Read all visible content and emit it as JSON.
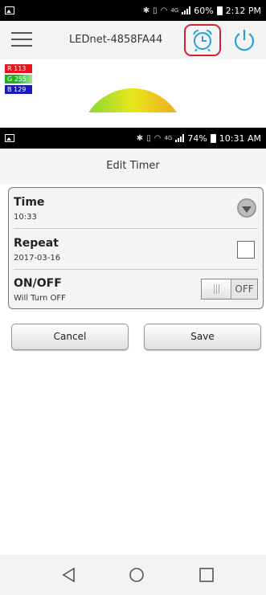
{
  "top_screen": {
    "status_bar": {
      "battery": "60%",
      "time": "2:12 PM",
      "network": "4G"
    },
    "app_bar": {
      "device_name": "LEDnet-4858FA44",
      "menu_icon": "hamburger-menu-icon",
      "timer_icon": "alarm-clock-icon",
      "power_icon": "power-icon"
    },
    "rgb": {
      "r": "R 113",
      "g": "G 255",
      "b": "B 129"
    }
  },
  "edit_timer": {
    "status_bar": {
      "battery": "74%",
      "time": "10:31 AM",
      "network": "4G"
    },
    "title": "Edit Timer",
    "time": {
      "label": "Time",
      "value": "10:33"
    },
    "repeat": {
      "label": "Repeat",
      "value": "2017-03-16",
      "checked": false
    },
    "onoff": {
      "label": "ON/OFF",
      "value": "Will Turn OFF",
      "toggle_state": "OFF"
    },
    "buttons": {
      "cancel": "Cancel",
      "save": "Save"
    }
  },
  "colors": {
    "accent_blue": "#2a9fd8",
    "highlight_red": "#d0252f",
    "red_swatch": "#e8141e",
    "green_swatch": "#1fb21f",
    "blue_swatch": "#1a1ab4"
  }
}
